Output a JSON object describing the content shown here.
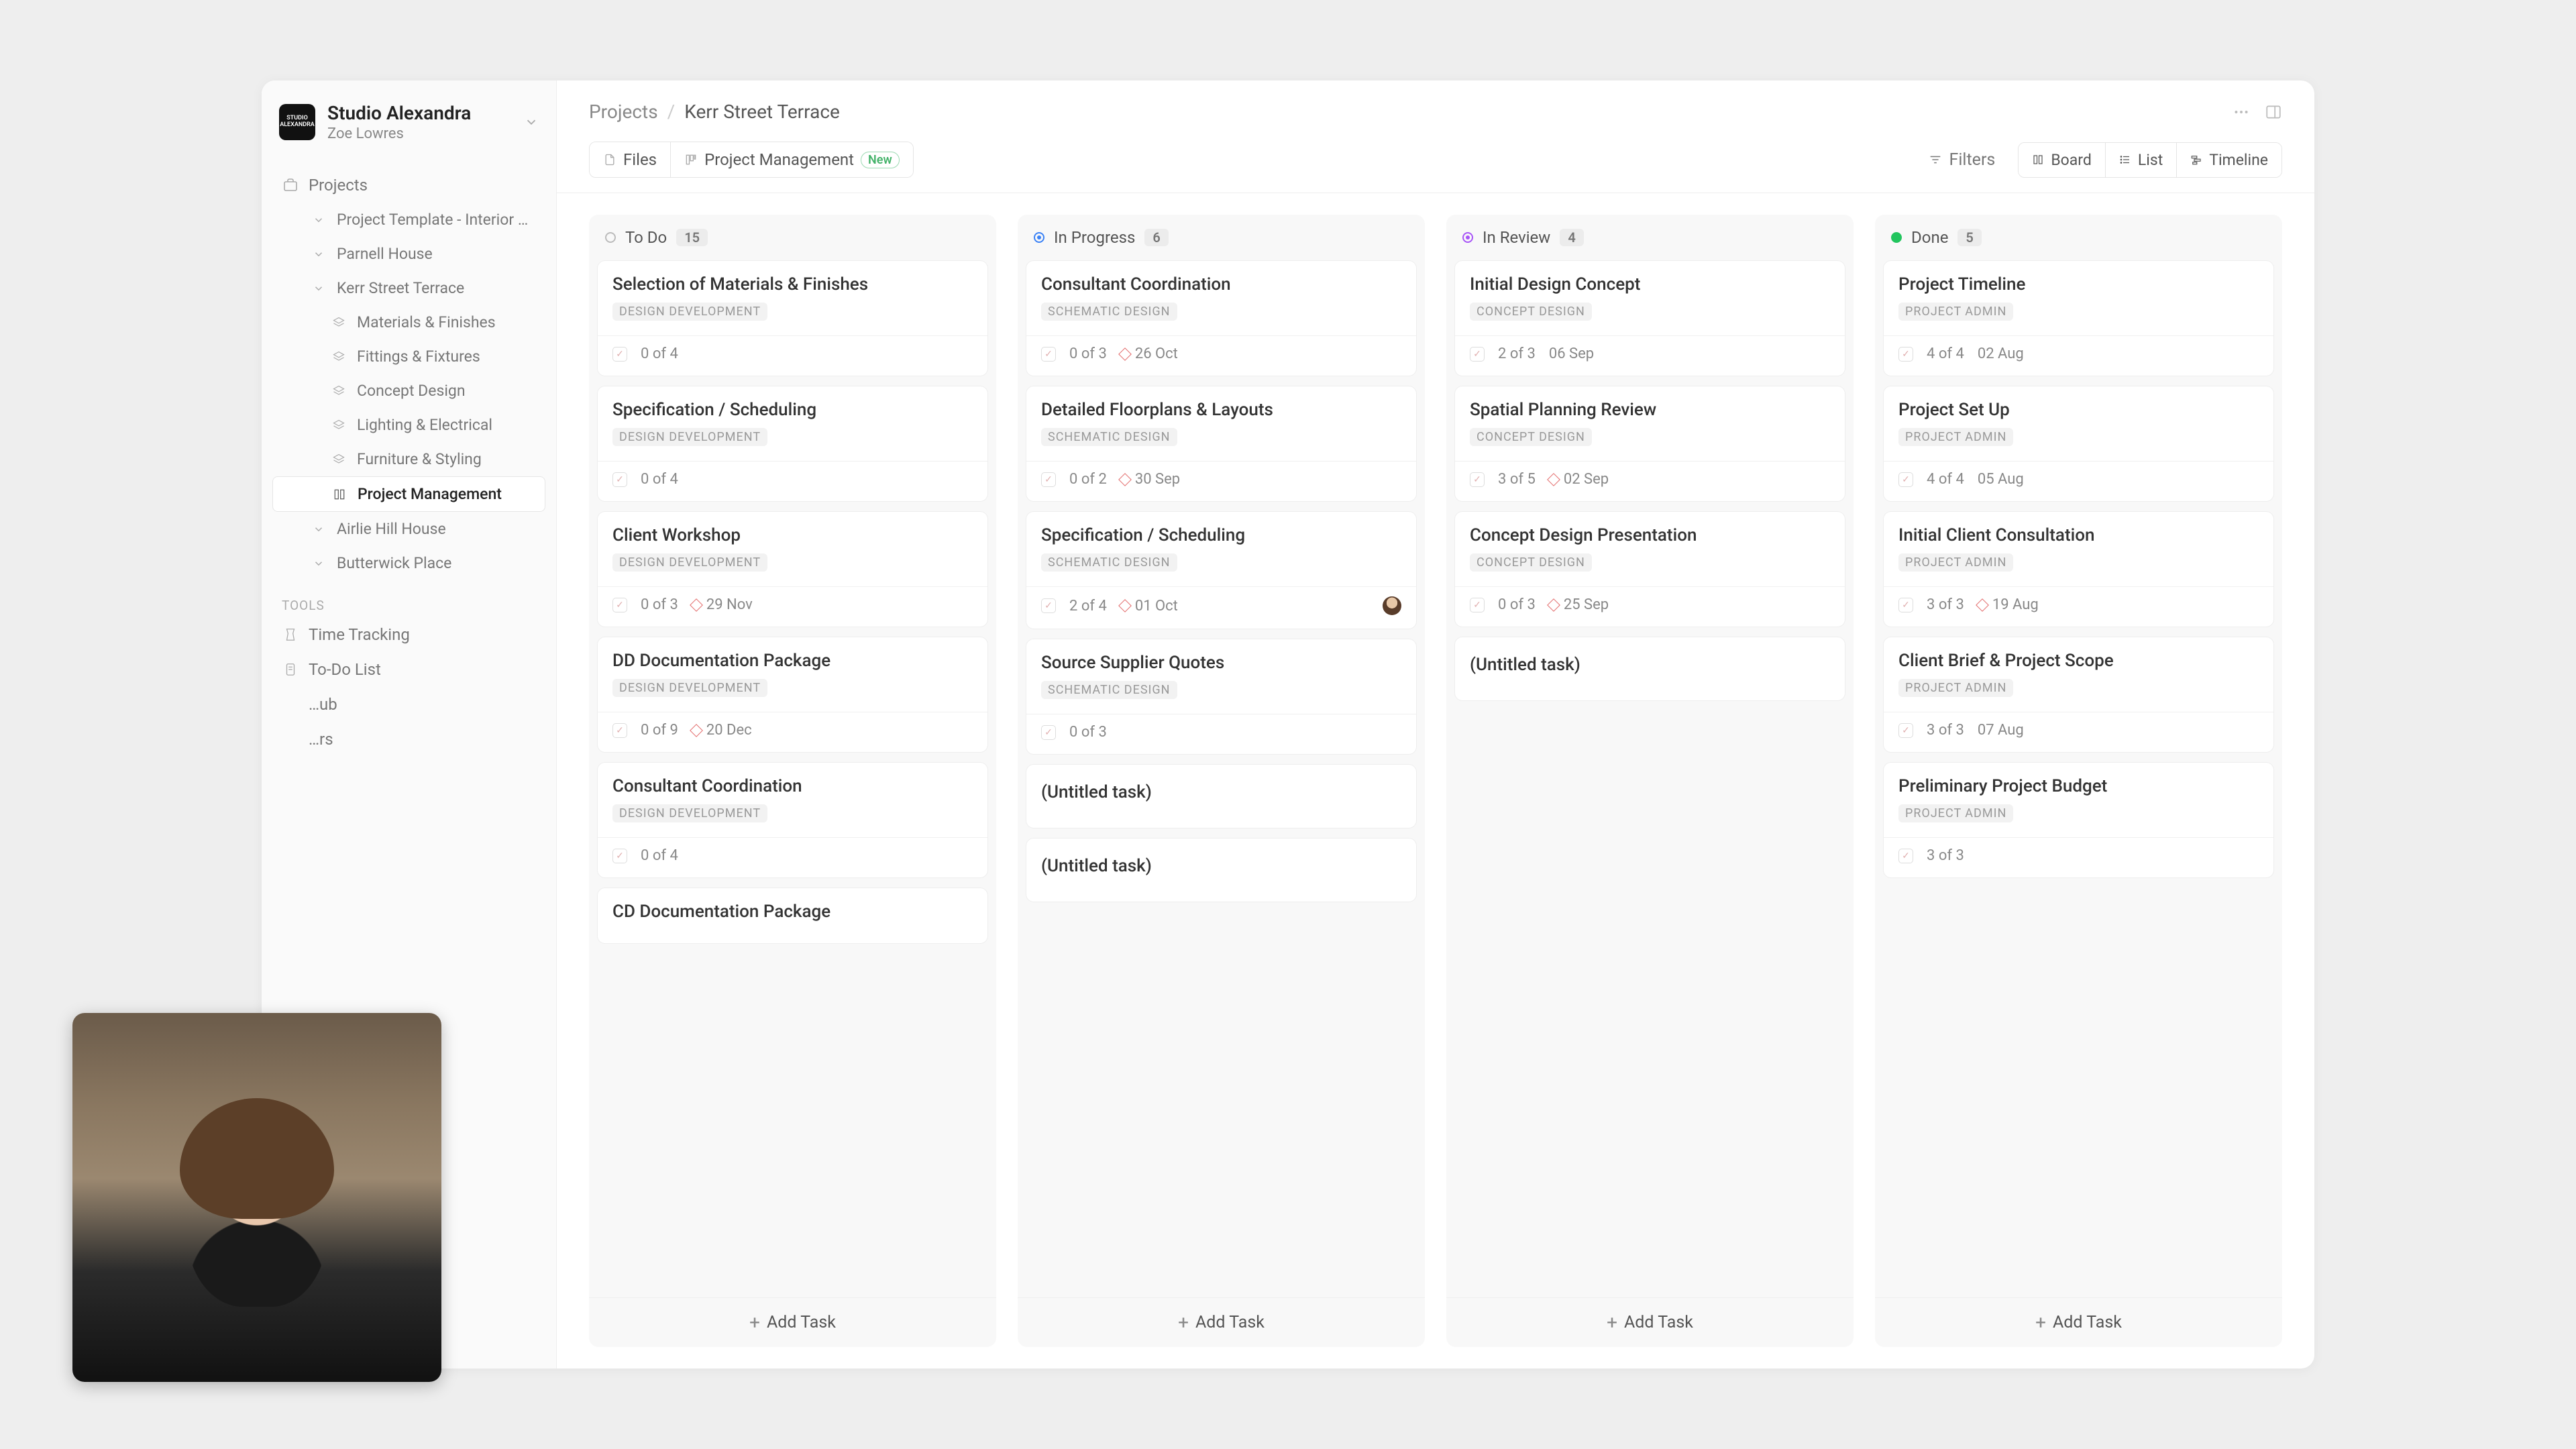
{
  "workspace": {
    "name": "Studio Alexandra",
    "user": "Zoe Lowres"
  },
  "nav": {
    "projects_label": "Projects",
    "projects": [
      {
        "label": "Project Template - Interior …"
      },
      {
        "label": "Parnell House"
      },
      {
        "label": "Kerr Street Terrace",
        "children": [
          {
            "label": "Materials & Finishes"
          },
          {
            "label": "Fittings & Fixtures"
          },
          {
            "label": "Concept Design"
          },
          {
            "label": "Lighting & Electrical"
          },
          {
            "label": "Furniture & Styling"
          },
          {
            "label": "Project Management",
            "active": true
          }
        ]
      },
      {
        "label": "Airlie Hill House"
      },
      {
        "label": "Butterwick Place"
      }
    ],
    "tools_label": "TOOLS",
    "tools": [
      {
        "label": "Time Tracking"
      },
      {
        "label": "To-Do List"
      },
      {
        "label": "…ub"
      },
      {
        "label": "…rs"
      }
    ]
  },
  "breadcrumb": {
    "root": "Projects",
    "current": "Kerr Street Terrace"
  },
  "tabs": {
    "files": "Files",
    "pm": "Project Management",
    "new_badge": "New"
  },
  "toolbar": {
    "filters": "Filters",
    "board": "Board",
    "list": "List",
    "timeline": "Timeline"
  },
  "columns": [
    {
      "status": "todo",
      "title": "To Do",
      "count": "15",
      "cards": [
        {
          "title": "Selection of Materials & Finishes",
          "tag": "DESIGN DEVELOPMENT",
          "progress": "0 of 4"
        },
        {
          "title": "Specification / Scheduling",
          "tag": "DESIGN DEVELOPMENT",
          "progress": "0 of 4"
        },
        {
          "title": "Client Workshop",
          "tag": "DESIGN DEVELOPMENT",
          "progress": "0 of 3",
          "due": "29 Nov"
        },
        {
          "title": "DD Documentation Package",
          "tag": "DESIGN DEVELOPMENT",
          "progress": "0 of 9",
          "due": "20 Dec"
        },
        {
          "title": "Consultant Coordination",
          "tag": "DESIGN DEVELOPMENT",
          "progress": "0 of 4"
        },
        {
          "title": "CD Documentation Package"
        }
      ]
    },
    {
      "status": "inprogress",
      "title": "In Progress",
      "count": "6",
      "cards": [
        {
          "title": "Consultant Coordination",
          "tag": "SCHEMATIC DESIGN",
          "progress": "0 of 3",
          "due": "26 Oct"
        },
        {
          "title": "Detailed Floorplans & Layouts",
          "tag": "SCHEMATIC DESIGN",
          "progress": "0 of 2",
          "due": "30 Sep"
        },
        {
          "title": "Specification / Scheduling",
          "tag": "SCHEMATIC DESIGN",
          "progress": "2 of 4",
          "due": "01 Oct",
          "avatar": true
        },
        {
          "title": "Source Supplier Quotes",
          "tag": "SCHEMATIC DESIGN",
          "progress": "0 of 3"
        },
        {
          "title": "(Untitled task)",
          "minimal": true
        },
        {
          "title": "(Untitled task)",
          "minimal": true
        }
      ]
    },
    {
      "status": "inreview",
      "title": "In Review",
      "count": "4",
      "cards": [
        {
          "title": "Initial Design Concept",
          "tag": "CONCEPT DESIGN",
          "progress": "2 of 3",
          "date": "06 Sep"
        },
        {
          "title": "Spatial Planning Review",
          "tag": "CONCEPT DESIGN",
          "progress": "3 of 5",
          "due": "02 Sep"
        },
        {
          "title": "Concept Design Presentation",
          "tag": "CONCEPT DESIGN",
          "progress": "0 of 3",
          "due": "25 Sep"
        },
        {
          "title": "(Untitled task)",
          "minimal": true
        }
      ]
    },
    {
      "status": "done",
      "title": "Done",
      "count": "5",
      "cards": [
        {
          "title": "Project Timeline",
          "tag": "PROJECT ADMIN",
          "progress": "4 of 4",
          "date": "02 Aug"
        },
        {
          "title": "Project Set Up",
          "tag": "PROJECT ADMIN",
          "progress": "4 of 4",
          "date": "05 Aug"
        },
        {
          "title": "Initial Client Consultation",
          "tag": "PROJECT ADMIN",
          "progress": "3 of 3",
          "due": "19 Aug"
        },
        {
          "title": "Client Brief & Project Scope",
          "tag": "PROJECT ADMIN",
          "progress": "3 of 3",
          "date": "07 Aug"
        },
        {
          "title": "Preliminary Project Budget",
          "tag": "PROJECT ADMIN",
          "progress": "3 of 3"
        }
      ]
    }
  ],
  "add_task_label": "Add Task"
}
